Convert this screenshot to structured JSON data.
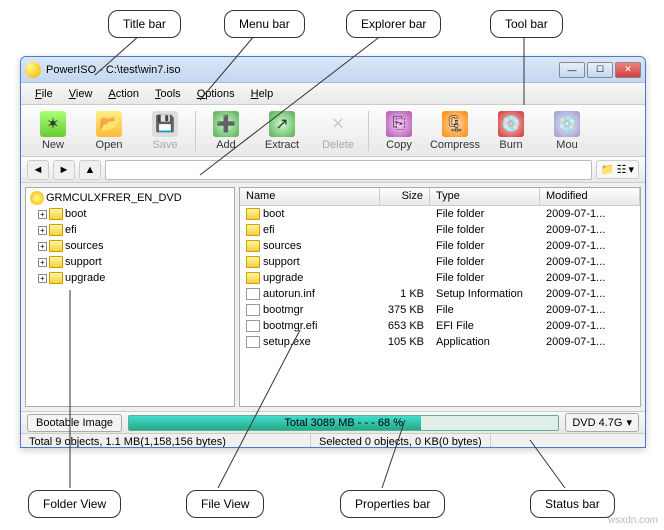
{
  "callouts": {
    "titlebar": "Title bar",
    "menubar": "Menu bar",
    "explorerbar": "Explorer bar",
    "toolbar": "Tool bar",
    "folderview": "Folder View",
    "fileview": "File View",
    "propsbar": "Properties bar",
    "statusbar": "Status bar"
  },
  "window": {
    "title": "PowerISO - C:\\test\\win7.iso"
  },
  "menu": {
    "items": [
      {
        "ul": "F",
        "rest": "ile"
      },
      {
        "ul": "V",
        "rest": "iew"
      },
      {
        "ul": "A",
        "rest": "ction"
      },
      {
        "ul": "T",
        "rest": "ools"
      },
      {
        "ul": "O",
        "rest": "ptions"
      },
      {
        "ul": "H",
        "rest": "elp"
      }
    ]
  },
  "toolbar": {
    "new": "New",
    "open": "Open",
    "save": "Save",
    "add": "Add",
    "extract": "Extract",
    "delete": "Delete",
    "copy": "Copy",
    "compress": "Compress",
    "burn": "Burn",
    "mount": "Mou"
  },
  "tree": {
    "root": "GRMCULXFRER_EN_DVD",
    "children": [
      "boot",
      "efi",
      "sources",
      "support",
      "upgrade"
    ]
  },
  "fileview": {
    "headers": {
      "name": "Name",
      "size": "Size",
      "type": "Type",
      "modified": "Modified"
    },
    "rows": [
      {
        "icon": "folder",
        "name": "boot",
        "size": "",
        "type": "File folder",
        "modified": "2009-07-1..."
      },
      {
        "icon": "folder",
        "name": "efi",
        "size": "",
        "type": "File folder",
        "modified": "2009-07-1..."
      },
      {
        "icon": "folder",
        "name": "sources",
        "size": "",
        "type": "File folder",
        "modified": "2009-07-1..."
      },
      {
        "icon": "folder",
        "name": "support",
        "size": "",
        "type": "File folder",
        "modified": "2009-07-1..."
      },
      {
        "icon": "folder",
        "name": "upgrade",
        "size": "",
        "type": "File folder",
        "modified": "2009-07-1..."
      },
      {
        "icon": "file",
        "name": "autorun.inf",
        "size": "1 KB",
        "type": "Setup Information",
        "modified": "2009-07-1..."
      },
      {
        "icon": "file",
        "name": "bootmgr",
        "size": "375 KB",
        "type": "File",
        "modified": "2009-07-1..."
      },
      {
        "icon": "file",
        "name": "bootmgr.efi",
        "size": "653 KB",
        "type": "EFI File",
        "modified": "2009-07-1..."
      },
      {
        "icon": "file",
        "name": "setup.exe",
        "size": "105 KB",
        "type": "Application",
        "modified": "2009-07-1..."
      }
    ]
  },
  "props": {
    "bootable": "Bootable Image",
    "progress_text": "Total  3089 MB   - - -  68 %",
    "dvd": "DVD 4.7G"
  },
  "status": {
    "left": "Total 9 objects, 1.1 MB(1,158,156 bytes)",
    "right": "Selected 0 objects, 0 KB(0 bytes)"
  },
  "watermark": "wsxdn.com"
}
